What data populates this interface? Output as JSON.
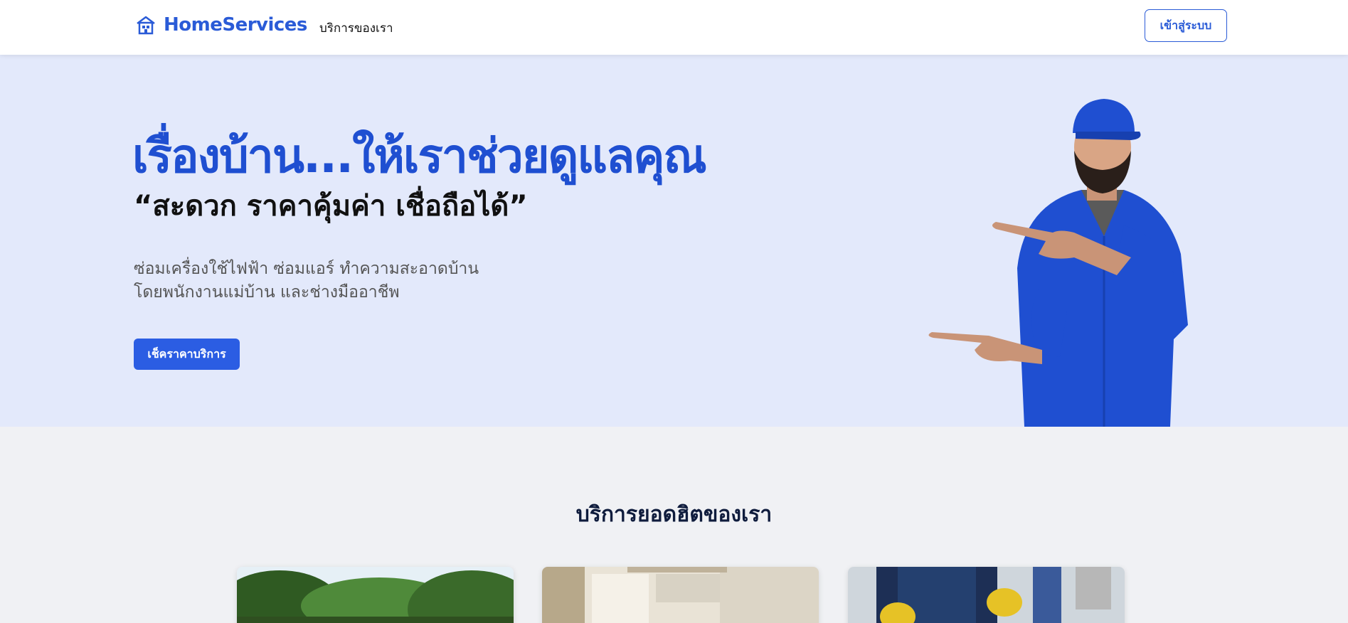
{
  "header": {
    "brand": "HomeServices",
    "nav_link": "บริการของเรา",
    "login_label": "เข้าสู่ระบบ"
  },
  "hero": {
    "title": "เรื่องบ้าน...ให้เราช่วยดูแลคุณ",
    "subtitle": "“สะดวก ราคาคุ้มค่า เชื่อถือได้”",
    "description_line1": "ซ่อมเครื่องใช้ไฟฟ้า ซ่อมแอร์ ทำความสะอาดบ้าน",
    "description_line2": "โดยพนักงานแม่บ้าน และช่างมืออาชีพ",
    "cta_label": "เช็คราคาบริการ"
  },
  "popular": {
    "title": "บริการยอดฮิตของเรา"
  },
  "colors": {
    "brand": "#2a5bd7",
    "hero_bg": "#e3e9fb",
    "cta": "#2b5de3"
  },
  "icons": {
    "logo": "house-icon"
  }
}
